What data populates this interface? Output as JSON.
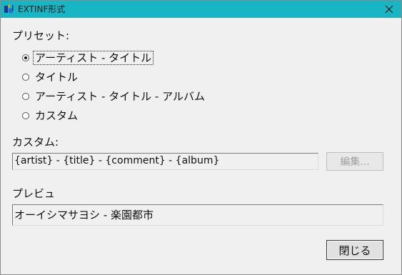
{
  "window": {
    "title": "EXTINF形式"
  },
  "preset": {
    "label": "プリセット:",
    "options": [
      {
        "label": "アーティスト - タイトル",
        "checked": true
      },
      {
        "label": "タイトル",
        "checked": false
      },
      {
        "label": "アーティスト - タイトル - アルバム",
        "checked": false
      },
      {
        "label": "カスタム",
        "checked": false
      }
    ]
  },
  "custom": {
    "label": "カスタム:",
    "value": "{artist} - {title} - {comment} - {album}",
    "edit_button": "編集..."
  },
  "preview": {
    "label": "プレビュ",
    "value": "オーイシマサヨシ - 楽園都市"
  },
  "footer": {
    "close_button": "閉じる"
  },
  "colors": {
    "titlebar": "#18b6c4",
    "background": "#f0f0f0"
  }
}
